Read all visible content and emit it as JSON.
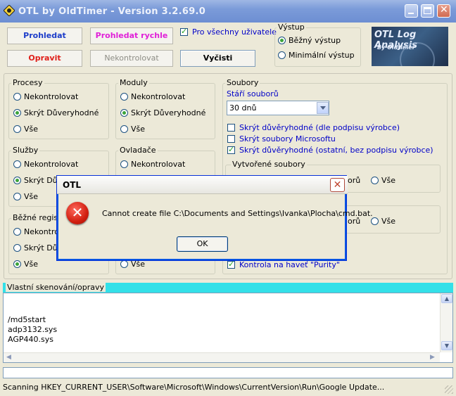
{
  "window": {
    "title": "OTL by OldTimer - Version 3.2.69.0"
  },
  "toolbar": {
    "scan_label": "Prohledat",
    "quick_scan_label": "Prohledat rychle",
    "fix_label": "Opravit",
    "none_label": "Nekontrolovat",
    "clear_label": "Vyčisti",
    "all_users_label": "Pro všechny uživatele"
  },
  "output": {
    "title": "Výstup",
    "standard": "Běžný výstup",
    "minimal": "Minimální výstup"
  },
  "logo": {
    "line1": "OTL Log Analysis",
    "line2": "By Oldtimer"
  },
  "processes": {
    "title": "Procesy",
    "opt1": "Nekontrolovat",
    "opt2": "Skrýt Důveryhodné",
    "opt3": "Vše"
  },
  "modules": {
    "title": "Moduly",
    "opt1": "Nekontrolovat",
    "opt2": "Skrýt Důveryhodné",
    "opt3": "Vše"
  },
  "services": {
    "title": "Služby",
    "opt1": "Nekontrolovat",
    "opt2": "Skrýt Dů",
    "opt3": "Vše"
  },
  "drivers": {
    "title": "Ovladače",
    "opt1": "Nekontrolovat"
  },
  "registry": {
    "title": "Běžné regist",
    "opt1": "Nekontrol",
    "opt2": "Skrýt Dův",
    "opt3": "Vše"
  },
  "extra": {
    "opt3": "Vše"
  },
  "files": {
    "title": "Soubory",
    "age_label": "Stáří souborů",
    "age_value": "30 dnů",
    "chk1": "Skrýt důvěryhodné (dle podpisu výrobce)",
    "chk2": "Skrýt soubory Microsoftu",
    "chk3": "Skrýt důvěryhodné (ostatní, bez podpisu výrobce)",
    "created_title": "Vytvořené soubory",
    "created_partial": "orů",
    "created_all": "Vše",
    "modified_partial": "orů",
    "modified_all": "Vše",
    "purity": "Kontrola na haveť \"Purity\""
  },
  "custom": {
    "title": "Vlastní skenování/opravy",
    "lines": [
      "/md5start",
      "adp3132.sys",
      "AGP440.sys"
    ]
  },
  "status": {
    "text": "Scanning HKEY_CURRENT_USER\\Software\\Microsoft\\Windows\\CurrentVersion\\Run\\Google Update..."
  },
  "dialog": {
    "title": "OTL",
    "message": "Cannot create file C:\\Documents and Settings\\Ivanka\\Plocha\\cmd.bat.",
    "ok_label": "OK",
    "close_glyph": "✕",
    "error_glyph": "✕"
  },
  "colors": {
    "title_bar": "#7b9bd9",
    "accent_cyan": "#33e0e8",
    "link_blue": "#0000c8"
  }
}
